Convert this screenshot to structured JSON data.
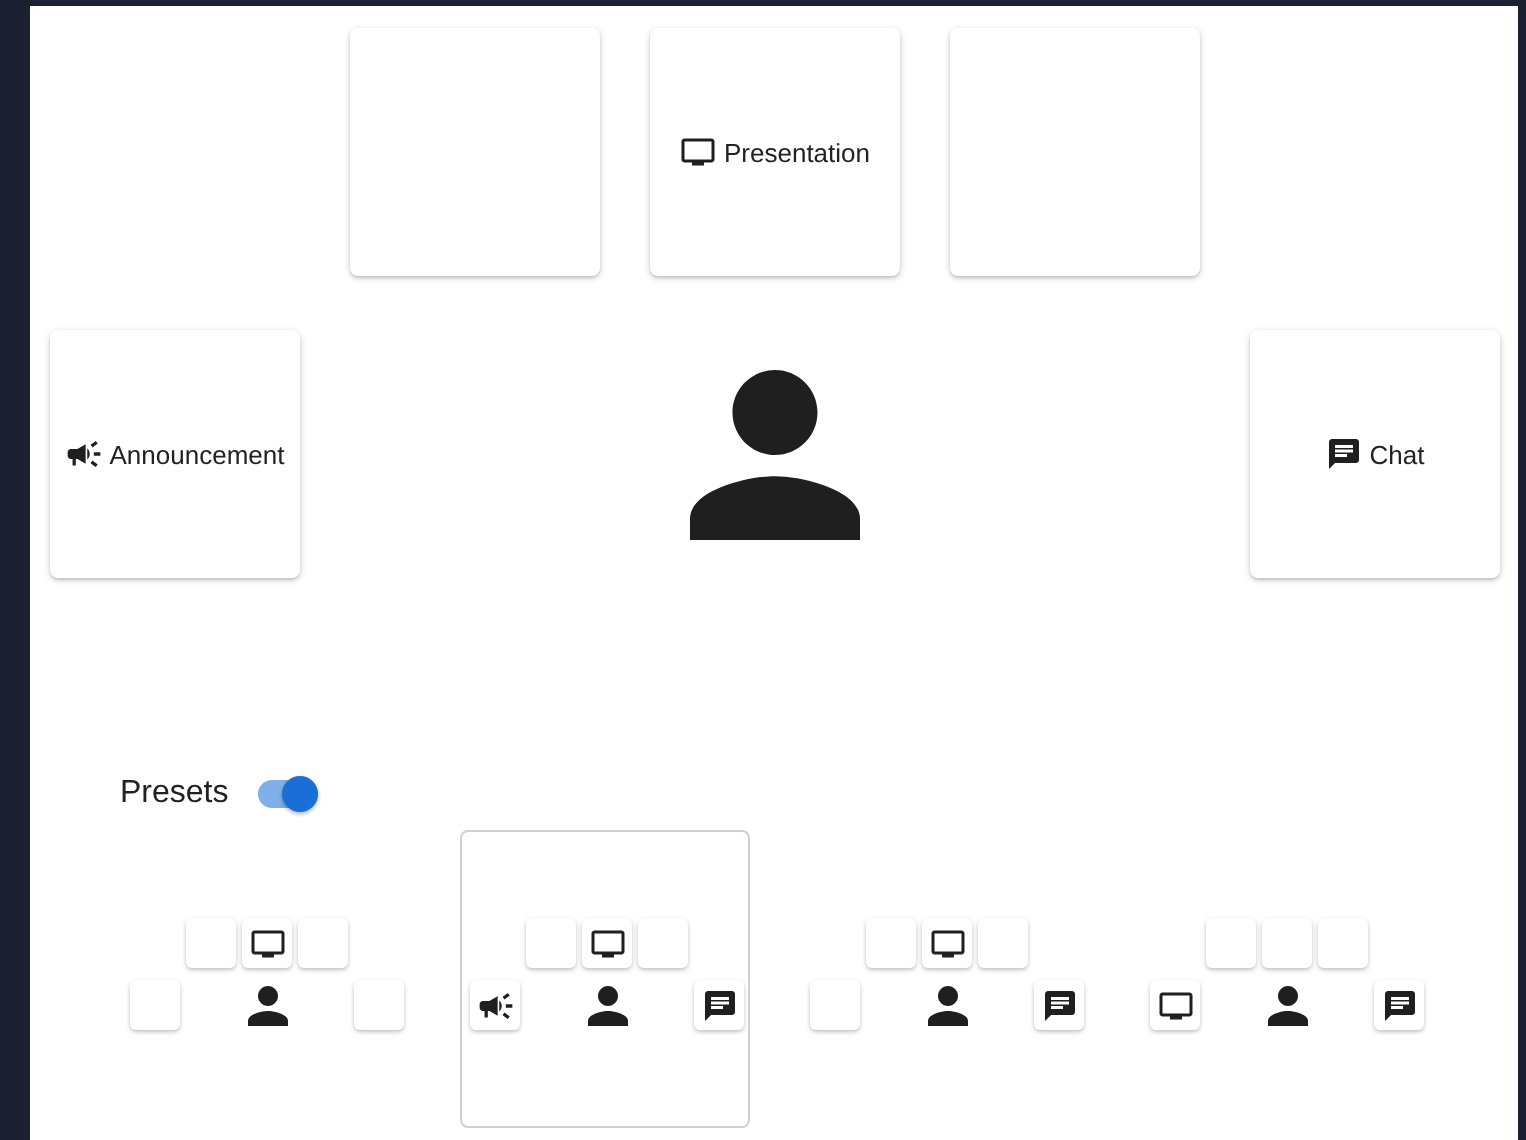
{
  "stage": {
    "top": [
      {
        "kind": "empty"
      },
      {
        "kind": "presentation",
        "label": "Presentation"
      },
      {
        "kind": "empty"
      }
    ],
    "left": {
      "kind": "announcement",
      "label": "Announcement"
    },
    "right": {
      "kind": "chat",
      "label": "Chat"
    }
  },
  "presets_toggle": {
    "label": "Presets",
    "on": true
  },
  "presets": [
    {
      "selected": false,
      "top": [
        {
          "kind": "empty"
        },
        {
          "kind": "presentation"
        },
        {
          "kind": "empty"
        }
      ],
      "left": {
        "kind": "empty"
      },
      "right": {
        "kind": "empty"
      }
    },
    {
      "selected": true,
      "top": [
        {
          "kind": "empty"
        },
        {
          "kind": "presentation"
        },
        {
          "kind": "empty"
        }
      ],
      "left": {
        "kind": "announcement"
      },
      "right": {
        "kind": "chat"
      }
    },
    {
      "selected": false,
      "top": [
        {
          "kind": "empty"
        },
        {
          "kind": "presentation"
        },
        {
          "kind": "empty"
        }
      ],
      "left": {
        "kind": "empty"
      },
      "right": {
        "kind": "chat"
      }
    },
    {
      "selected": false,
      "top": [
        {
          "kind": "empty"
        },
        {
          "kind": "empty"
        },
        {
          "kind": "empty"
        }
      ],
      "left": {
        "kind": "presentation"
      },
      "right": {
        "kind": "chat"
      }
    }
  ]
}
